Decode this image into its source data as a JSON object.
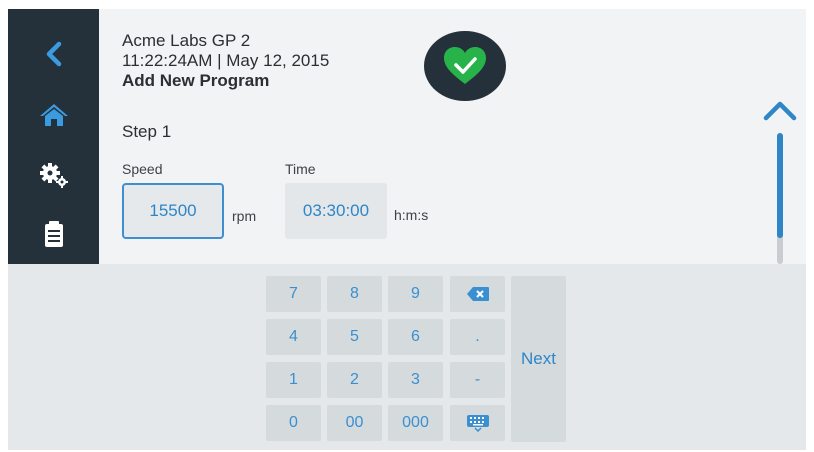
{
  "header": {
    "device_name": "Acme Labs GP 2",
    "datetime": "11:22:24AM | May 12, 2015",
    "page_title": "Add New Program"
  },
  "sidebar": {
    "items": [
      {
        "icon": "back-chevron-icon"
      },
      {
        "icon": "home-icon"
      },
      {
        "icon": "gears-icon"
      },
      {
        "icon": "clipboard-icon"
      }
    ]
  },
  "status": {
    "icon": "heart-check-icon",
    "color": "#27b34a"
  },
  "step": {
    "title": "Step 1"
  },
  "speed": {
    "label": "Speed",
    "value": "15500",
    "unit": "rpm"
  },
  "time": {
    "label": "Time",
    "value": "03:30:00",
    "unit": "h:m:s"
  },
  "keypad": {
    "keys": {
      "k7": "7",
      "k8": "8",
      "k9": "9",
      "k4": "4",
      "k5": "5",
      "k6": "6",
      "k1": "1",
      "k2": "2",
      "k3": "3",
      "k0": "0",
      "k00": "00",
      "k000": "000",
      "dot": ".",
      "minus": "-"
    },
    "backspace_icon": "backspace-icon",
    "keyboard_icon": "keyboard-icon",
    "next_label": "Next"
  },
  "colors": {
    "accent": "#2e86c8",
    "sidebar": "#24303a",
    "success": "#27b34a"
  }
}
